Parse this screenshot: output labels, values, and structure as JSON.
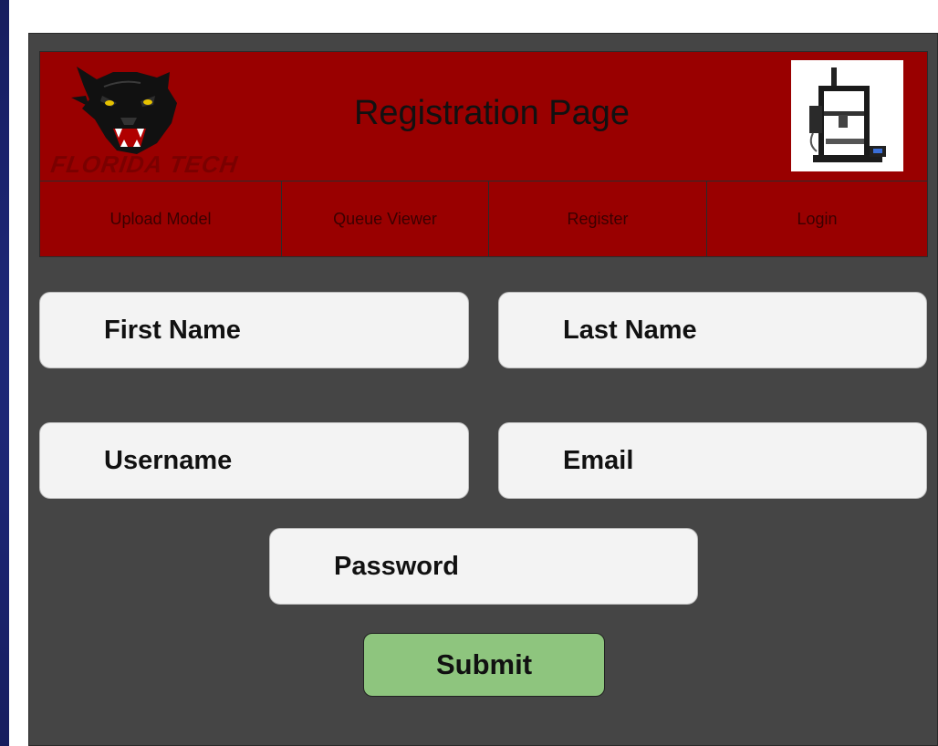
{
  "header": {
    "logo_text": "FLORIDA TECH",
    "title": "Registration Page",
    "printer_icon": "3d-printer-image"
  },
  "nav": {
    "items": [
      {
        "label": "Upload Model"
      },
      {
        "label": "Queue Viewer"
      },
      {
        "label": "Register"
      },
      {
        "label": "Login"
      }
    ]
  },
  "form": {
    "first_name_placeholder": "First Name",
    "last_name_placeholder": "Last Name",
    "username_placeholder": "Username",
    "email_placeholder": "Email",
    "password_placeholder": "Password",
    "submit_label": "Submit"
  },
  "colors": {
    "header_red": "#990000",
    "panel_gray": "#454545",
    "submit_green": "#8ec57e",
    "slide_blue": "#1e2a78"
  }
}
